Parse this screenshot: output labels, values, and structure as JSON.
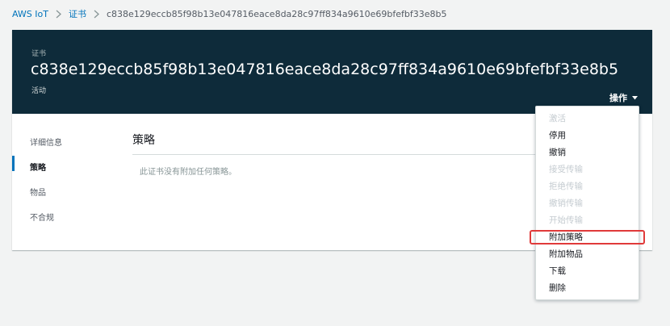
{
  "breadcrumb": {
    "root": "AWS IoT",
    "section": "证书",
    "current": "c838e129eccb85f98b13e047816eace8da28c97ff834a9610e69bfefbf33e8b5"
  },
  "header": {
    "label": "证书",
    "title": "c838e129eccb85f98b13e047816eace8da28c97ff834a9610e69bfefbf33e8b5",
    "status": "活动",
    "actions_label": "操作"
  },
  "sidenav": {
    "items": [
      "详细信息",
      "策略",
      "物品",
      "不合规"
    ],
    "active": "策略"
  },
  "main": {
    "section_title": "策略",
    "empty_message": "此证书没有附加任何策略。"
  },
  "actions_menu": {
    "items": [
      {
        "label": "激活",
        "disabled": true
      },
      {
        "label": "停用",
        "disabled": false
      },
      {
        "label": "撤销",
        "disabled": false
      },
      {
        "label": "接受传输",
        "disabled": true
      },
      {
        "label": "拒绝传输",
        "disabled": true
      },
      {
        "label": "撤销传输",
        "disabled": true
      },
      {
        "label": "开始传输",
        "disabled": true
      },
      {
        "label": "附加策略",
        "disabled": false
      },
      {
        "label": "附加物品",
        "disabled": false
      },
      {
        "label": "下载",
        "disabled": false
      },
      {
        "label": "删除",
        "disabled": false
      }
    ],
    "highlighted": "附加策略"
  },
  "colors": {
    "header_bg": "#0e2b3a",
    "link": "#0073bb",
    "highlight": "#e03a3a"
  }
}
